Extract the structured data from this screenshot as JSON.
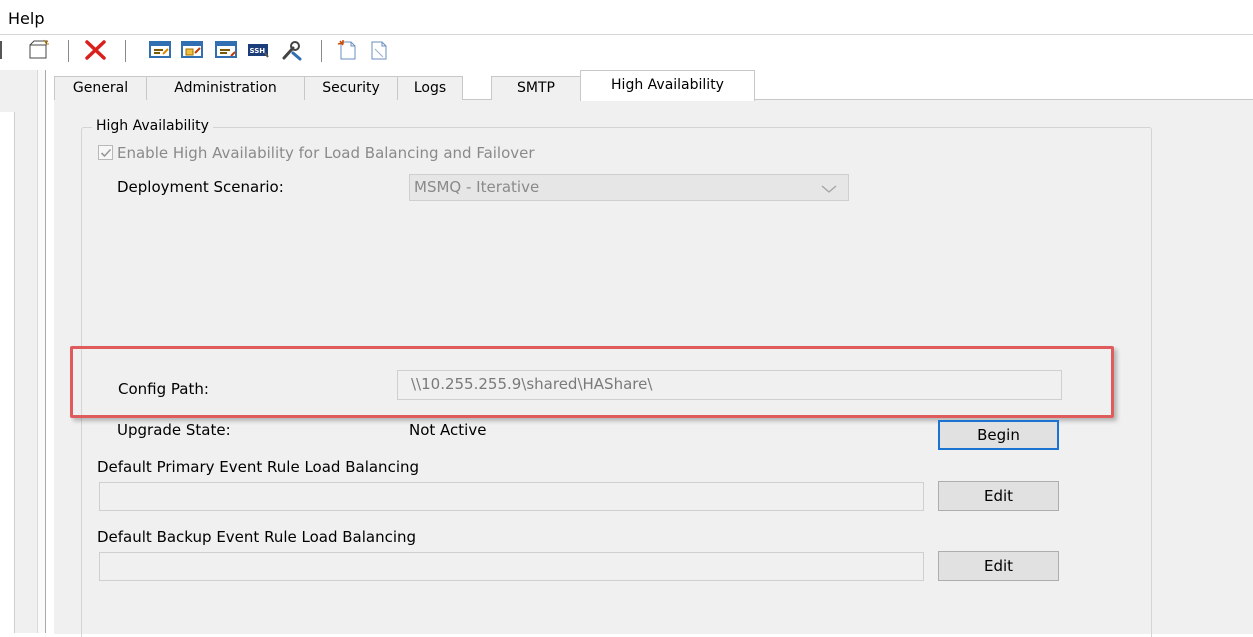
{
  "menu": {
    "help_label": "Help"
  },
  "toolbar": {
    "icons": [
      "new-item-icon",
      "delete-icon",
      "screen-edit-icon",
      "screen-fold-icon",
      "screen-rule-icon",
      "ssh-icon",
      "tools-icon",
      "new-document-icon",
      "document-icon"
    ]
  },
  "tabs": {
    "general": "General",
    "administration": "Administration",
    "security": "Security",
    "logs": "Logs",
    "smtp": "SMTP",
    "high_availability": "High Availability"
  },
  "ha": {
    "group_title": "High Availability",
    "enable_label": "Enable High Availability for Load Balancing and Failover",
    "enable_checked": true,
    "scenario_label": "Deployment Scenario:",
    "scenario_value": "MSMQ - Iterative",
    "config_label": "Config Path:",
    "config_value": "\\\\10.255.255.9\\shared\\HAShare\\",
    "upgrade_label": "Upgrade State:",
    "upgrade_value": "Not Active",
    "begin_label": "Begin",
    "primary_label": "Default Primary Event Rule Load Balancing",
    "primary_value": "",
    "primary_edit": "Edit",
    "backup_label": "Default Backup Event Rule Load Balancing",
    "backup_value": "",
    "backup_edit": "Edit"
  },
  "colors": {
    "highlight": "#e05b5b",
    "focus_border": "#1a73d1",
    "delete_icon": "#d9201c"
  }
}
